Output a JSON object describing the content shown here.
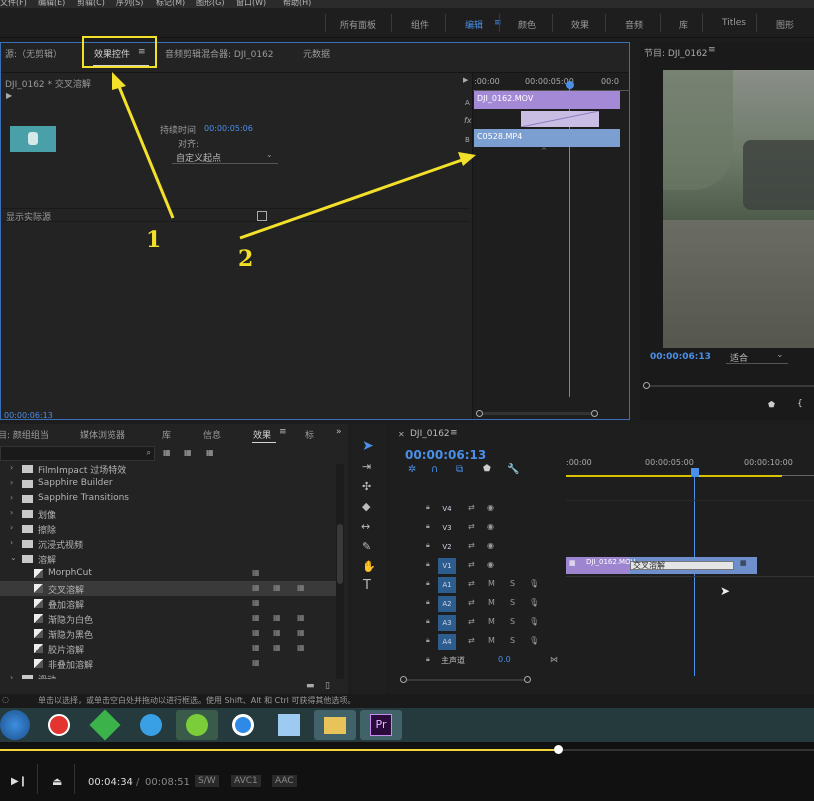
{
  "menubar": [
    "文件(F)",
    "编辑(E)",
    "剪辑(C)",
    "序列(S)",
    "标记(M)",
    "图形(G)",
    "窗口(W)",
    "帮助(H)"
  ],
  "workspaces": [
    {
      "label": "所有面板",
      "active": false
    },
    {
      "label": "组件",
      "active": false
    },
    {
      "label": "编辑",
      "active": true
    },
    {
      "label": "颜色",
      "active": false
    },
    {
      "label": "效果",
      "active": false
    },
    {
      "label": "音频",
      "active": false
    },
    {
      "label": "库",
      "active": false
    },
    {
      "label": "Titles",
      "active": false
    },
    {
      "label": "图形",
      "active": false
    }
  ],
  "source_panel": {
    "tabs": [
      "源:（无剪辑）",
      "效果控件",
      "音频剪辑混合器: DJI_0162",
      "元数据"
    ],
    "clip_title": "DJI_0162 * 交叉溶解",
    "duration_label": "持续时间",
    "duration_value": "00:00:05:06",
    "align_label": "对齐:",
    "align_value": "自定义起点",
    "show_actual_label": "显示实际源",
    "timecode": "00:00:06:13",
    "ruler_start": ":00:00",
    "ruler_mid": "00:00:05:00",
    "ruler_end": "00:0",
    "track_a": "A",
    "track_b": "B",
    "fx": "fx",
    "clip_a": "DJI_0162.MOV",
    "clip_b": "C0528.MP4"
  },
  "annotations": {
    "label1": "1",
    "label2": "2"
  },
  "program_panel": {
    "title": "节目: DJI_0162",
    "timecode": "00:00:06:13",
    "fit_label": "适合"
  },
  "effects_panel": {
    "tabs": [
      "目: 颜组组当",
      "媒体浏览器",
      "库",
      "信息",
      "效果",
      "标"
    ],
    "search_placeholder": "",
    "items": [
      {
        "label": "FilmImpact 过场特效",
        "indent": 1,
        "type": "folder",
        "expanded": false
      },
      {
        "label": "Sapphire Builder",
        "indent": 1,
        "type": "folder",
        "expanded": false
      },
      {
        "label": "Sapphire Transitions",
        "indent": 1,
        "type": "folder",
        "expanded": false
      },
      {
        "label": "划像",
        "indent": 1,
        "type": "folder",
        "expanded": false
      },
      {
        "label": "擦除",
        "indent": 1,
        "type": "folder",
        "expanded": false
      },
      {
        "label": "沉浸式视频",
        "indent": 1,
        "type": "folder",
        "expanded": false
      },
      {
        "label": "溶解",
        "indent": 1,
        "type": "folder",
        "expanded": true
      },
      {
        "label": "MorphCut",
        "indent": 2,
        "type": "effect",
        "badges": 1,
        "selected": false
      },
      {
        "label": "交叉溶解",
        "indent": 2,
        "type": "effect",
        "badges": 3,
        "selected": true
      },
      {
        "label": "叠加溶解",
        "indent": 2,
        "type": "effect",
        "badges": 1,
        "selected": false
      },
      {
        "label": "渐隐为白色",
        "indent": 2,
        "type": "effect",
        "badges": 3,
        "selected": false
      },
      {
        "label": "渐隐为黑色",
        "indent": 2,
        "type": "effect",
        "badges": 3,
        "selected": false
      },
      {
        "label": "胶片溶解",
        "indent": 2,
        "type": "effect",
        "badges": 3,
        "selected": false
      },
      {
        "label": "非叠加溶解",
        "indent": 2,
        "type": "effect",
        "badges": 1,
        "selected": false
      },
      {
        "label": "滑动",
        "indent": 1,
        "type": "folder",
        "expanded": false
      }
    ]
  },
  "timeline_panel": {
    "title": "DJI_0162",
    "timecode": "00:00:06:13",
    "ruler": [
      ":00:00",
      "00:00:05:00",
      "00:00:10:00"
    ],
    "video_tracks": [
      "V4",
      "V3",
      "V2",
      "V1"
    ],
    "audio_tracks": [
      "A1",
      "A2",
      "A3",
      "A4"
    ],
    "master_label": "主声道",
    "master_value": "0.0",
    "clip_v1": "DJI_0162.MOV",
    "transition_label": "交叉溶解",
    "m": "M",
    "s": "S"
  },
  "status_text": "单击以选择，或单击空白处并拖动以进行框选。使用 Shift、Alt 和 Ctrl 可获得其他选项。",
  "player": {
    "current_time": "00:04:34",
    "separator": "/",
    "total_time": "00:08:51",
    "badges": [
      "S/W",
      "AVC1",
      "AAC"
    ],
    "progress": 0.685
  }
}
